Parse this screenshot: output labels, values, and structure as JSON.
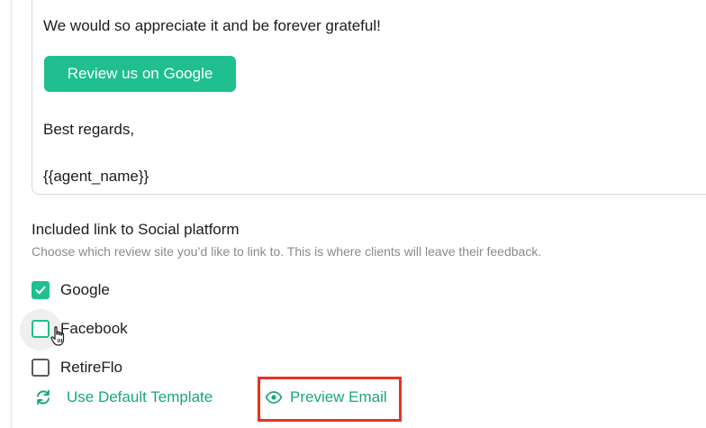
{
  "email_body": {
    "appreciation_line": "We would so appreciate it and be forever grateful!",
    "cta_button_label": "Review us on Google",
    "signoff": "Best regards,",
    "signature_placeholder": "{{agent_name}}"
  },
  "social_section": {
    "title": "Included link to Social platform",
    "subtitle": "Choose which review site you’d like to link to. This is where clients will leave their feedback.",
    "options": [
      {
        "label": "Google",
        "checked": true
      },
      {
        "label": "Facebook",
        "checked": false
      },
      {
        "label": "RetireFlo",
        "checked": false
      }
    ]
  },
  "actions": {
    "default_template_label": "Use Default Template",
    "preview_email_label": "Preview Email"
  },
  "colors": {
    "accent": "#1fbf8f",
    "link": "#1aa67a",
    "highlight": "#e8321f"
  }
}
